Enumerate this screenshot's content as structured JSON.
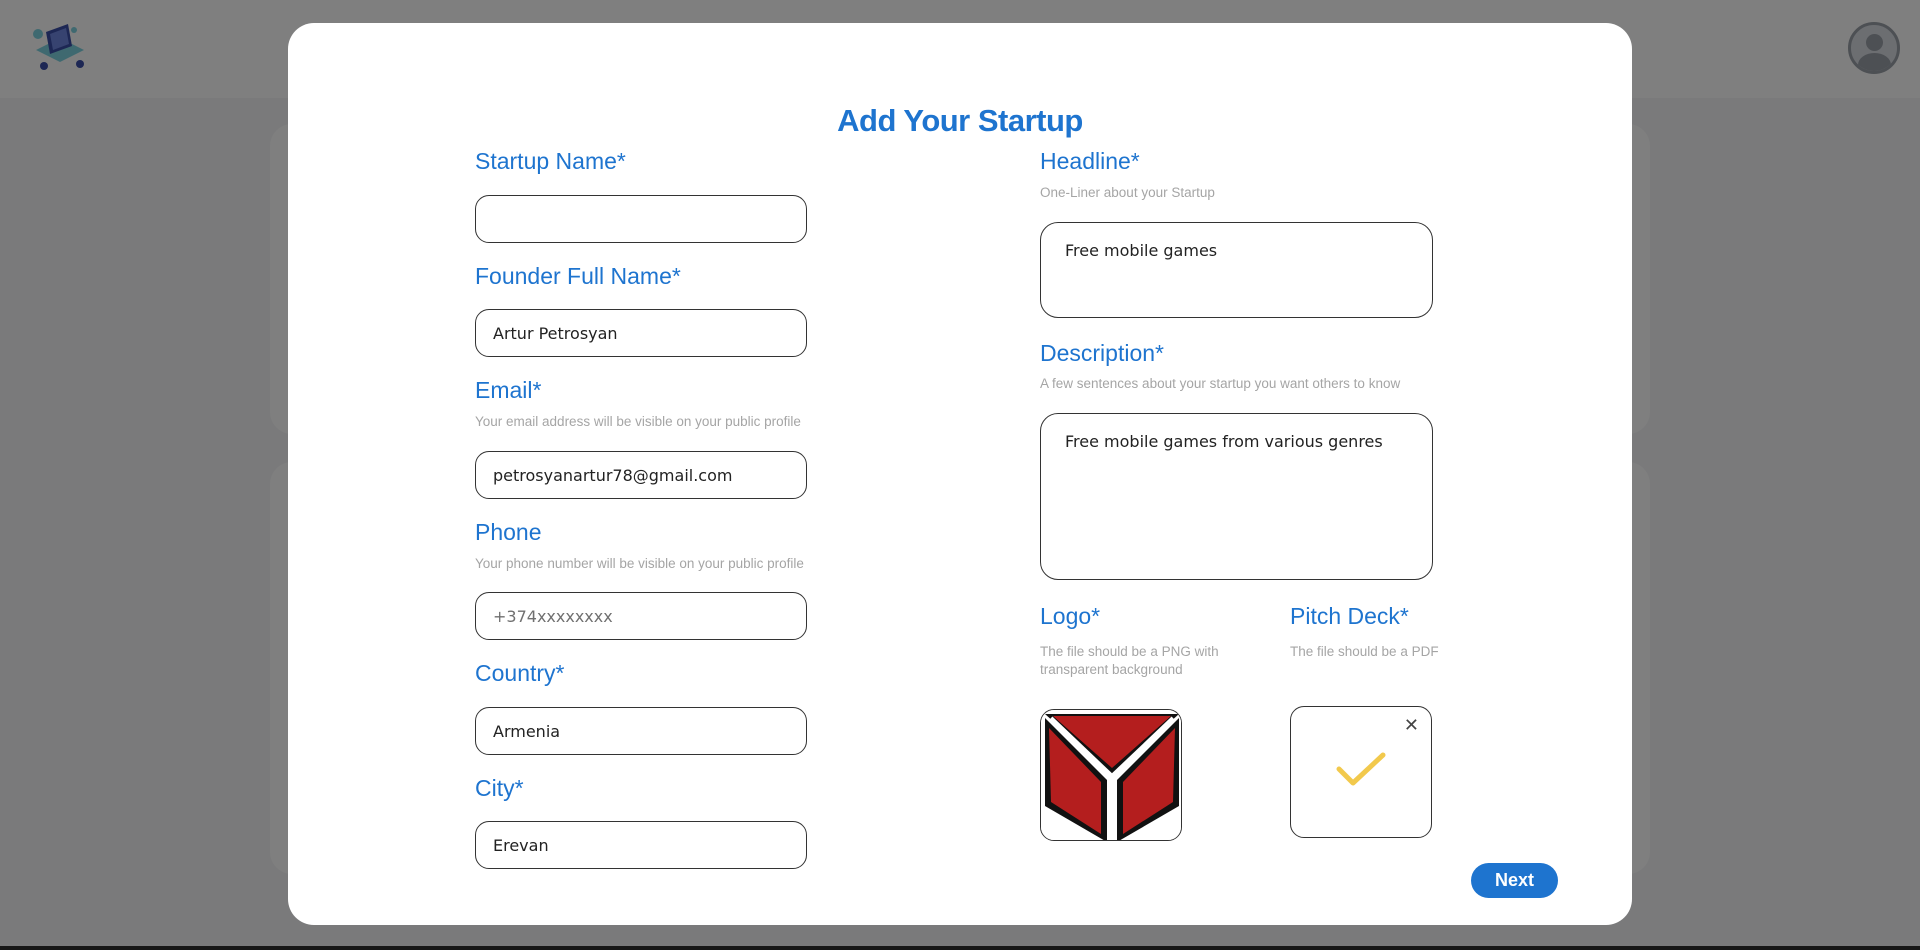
{
  "modal": {
    "title": "Add Your Startup",
    "next_label": "Next"
  },
  "left": {
    "startup_name": {
      "label": "Startup Name*",
      "value": ""
    },
    "founder": {
      "label": "Founder Full Name*",
      "value": "Artur Petrosyan"
    },
    "email": {
      "label": "Email*",
      "hint": "Your email address will be visible on your public profile",
      "value": "petrosyanartur78@gmail.com"
    },
    "phone": {
      "label": "Phone",
      "hint": "Your phone number will be visible on your public profile",
      "value": "",
      "placeholder": "+374xxxxxxxx"
    },
    "country": {
      "label": "Country*",
      "value": "Armenia"
    },
    "city": {
      "label": "City*",
      "value": "Erevan"
    }
  },
  "right": {
    "headline": {
      "label": "Headline*",
      "hint": "One-Liner about your Startup",
      "value": "Free mobile games"
    },
    "description": {
      "label": "Description*",
      "hint": "A few sentences about your startup you want others to know",
      "value": "Free mobile games from various genres"
    },
    "logo": {
      "label": "Logo*",
      "hint": "The file should be a PNG with transparent background",
      "icon": "shield-logo-icon"
    },
    "pitch_deck": {
      "label": "Pitch Deck*",
      "hint": "The file should be a PDF",
      "close_symbol": "✕",
      "icon": "checkmark-icon"
    }
  },
  "colors": {
    "accent": "#1e74cf",
    "hint_text": "#a5a5a5",
    "logo_red": "#b41e1e",
    "check_yellow": "#f2c94c"
  }
}
